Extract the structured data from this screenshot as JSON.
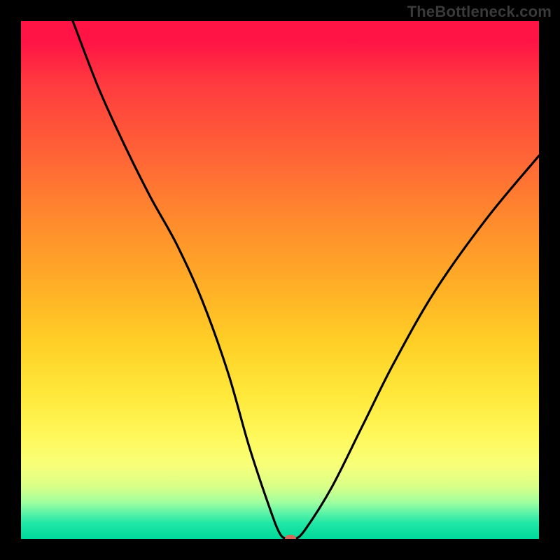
{
  "watermark": "TheBottleneck.com",
  "chart_data": {
    "type": "line",
    "title": "",
    "xlabel": "",
    "ylabel": "",
    "xlim": [
      0,
      100
    ],
    "ylim": [
      0,
      100
    ],
    "grid": false,
    "legend": false,
    "series": [
      {
        "name": "curve",
        "x": [
          10,
          15,
          20,
          25,
          30,
          35,
          40,
          44,
          48,
          50,
          51.5,
          53,
          55,
          60,
          66,
          72,
          80,
          90,
          100
        ],
        "y": [
          100,
          87,
          76,
          66,
          57,
          46,
          32,
          18,
          6,
          1,
          0,
          0,
          2,
          10,
          22,
          34,
          48,
          62,
          74
        ]
      }
    ],
    "marker": {
      "x": 52,
      "y": 0,
      "color": "#d36a5a"
    },
    "background_gradient": {
      "top": "#ff1445",
      "bottom": "#00d99a",
      "mid_tones": [
        "#ff6a35",
        "#ffb126",
        "#ffe83a",
        "#d7ff88"
      ]
    }
  },
  "colors": {
    "frame": "#000000",
    "curve": "#000000",
    "watermark": "#3a3a3a"
  }
}
